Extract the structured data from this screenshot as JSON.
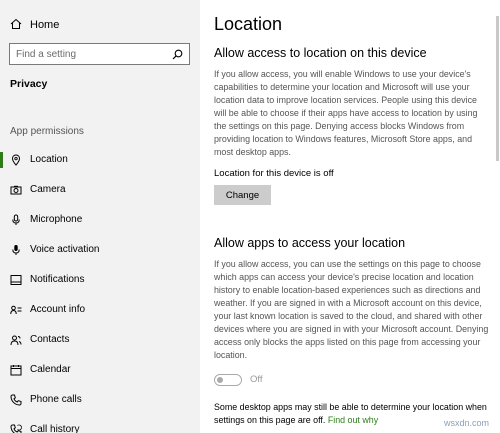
{
  "sidebar": {
    "home_label": "Home",
    "search_placeholder": "Find a setting",
    "section_heading": "Privacy",
    "group_label": "App permissions",
    "items": [
      {
        "label": "Location",
        "icon": "location-icon"
      },
      {
        "label": "Camera",
        "icon": "camera-icon"
      },
      {
        "label": "Microphone",
        "icon": "microphone-icon"
      },
      {
        "label": "Voice activation",
        "icon": "voice-activation-icon"
      },
      {
        "label": "Notifications",
        "icon": "notifications-icon"
      },
      {
        "label": "Account info",
        "icon": "account-info-icon"
      },
      {
        "label": "Contacts",
        "icon": "contacts-icon"
      },
      {
        "label": "Calendar",
        "icon": "calendar-icon"
      },
      {
        "label": "Phone calls",
        "icon": "phone-calls-icon"
      },
      {
        "label": "Call history",
        "icon": "call-history-icon"
      }
    ],
    "active_item": "Location"
  },
  "main": {
    "title": "Location",
    "section1": {
      "heading": "Allow access to location on this device",
      "body": "If you allow access, you will enable Windows to use your device's capabilities to determine your location and Microsoft will use your location data to improve location services. People using this device will be able to choose if their apps have access to location by using the settings on this page. Denying access blocks Windows from providing location to Windows features, Microsoft Store apps, and most desktop apps.",
      "status": "Location for this device is off",
      "change_label": "Change"
    },
    "section2": {
      "heading": "Allow apps to access your location",
      "body": "If you allow access, you can use the settings on this page to choose which apps can access your device's precise location and location history to enable location-based experiences such as directions and weather. If you are signed in with a Microsoft account on this device, your last known location is saved to the cloud, and shared with other devices where you are signed in with your Microsoft account. Denying access only blocks the apps listed on this page from accessing your location.",
      "toggle_label": "Off",
      "toggle_on": false,
      "note": "Some desktop apps may still be able to determine your location when settings on this page are off.",
      "note_link": "Find out why"
    }
  },
  "watermark": "wsxdn.com",
  "colors": {
    "sidebar_bg": "#f2f2f2",
    "accent": "#2e7d1b",
    "button_bg": "#cccccc",
    "muted_text": "#555555"
  }
}
